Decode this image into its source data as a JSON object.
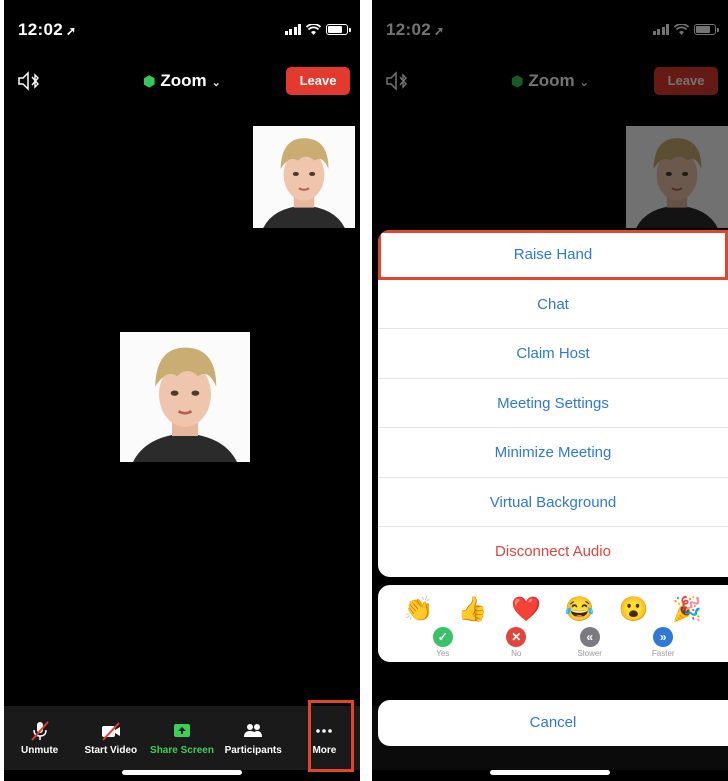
{
  "status_bar": {
    "time": "12:02"
  },
  "header": {
    "meeting_title": "Zoom",
    "leave_label": "Leave"
  },
  "toolbar": {
    "items": [
      {
        "label": "Unmute",
        "icon": "microphone-muted-icon"
      },
      {
        "label": "Start Video",
        "icon": "video-off-icon"
      },
      {
        "label": "Share Screen",
        "icon": "share-screen-icon"
      },
      {
        "label": "Participants",
        "icon": "participants-icon"
      },
      {
        "label": "More",
        "icon": "more-dots-icon"
      }
    ]
  },
  "more_menu": {
    "items": [
      {
        "label": "Raise Hand"
      },
      {
        "label": "Chat"
      },
      {
        "label": "Claim Host"
      },
      {
        "label": "Meeting Settings"
      },
      {
        "label": "Minimize Meeting"
      },
      {
        "label": "Virtual Background"
      },
      {
        "label": "Disconnect Audio"
      }
    ],
    "reactions": [
      "👏",
      "👍",
      "❤️",
      "😂",
      "😮",
      "🎉"
    ],
    "feedback": [
      {
        "label": "Yes",
        "color": "#3ac26a",
        "glyph": "✓"
      },
      {
        "label": "No",
        "color": "#e0453e",
        "glyph": "✕"
      },
      {
        "label": "Slower",
        "color": "#7a7a80",
        "glyph": "«"
      },
      {
        "label": "Faster",
        "color": "#2e78d6",
        "glyph": "»"
      }
    ],
    "cancel_label": "Cancel"
  },
  "colors": {
    "accent": "#2e78d6",
    "leave": "#e23a2e",
    "highlight": "#e2452b",
    "share": "#3ad05c"
  }
}
